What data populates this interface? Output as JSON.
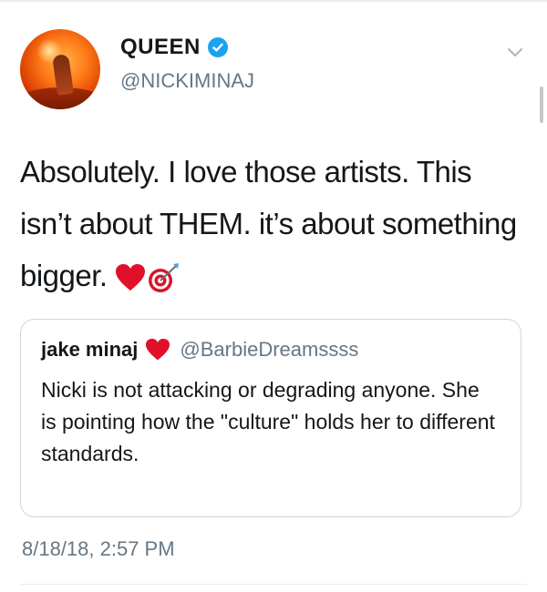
{
  "tweet": {
    "display_name": "QUEEN",
    "handle": "@NICKIMINAJ",
    "text": "Absolutely. I love those artists. This isn’t about THEM. it’s about something bigger.",
    "emojis": [
      "red-heart-icon",
      "direct-hit-icon"
    ],
    "timestamp": "8/18/18, 2:57 PM"
  },
  "quoted_tweet": {
    "display_name": "jake minaj",
    "handle": "@BarbieDreamssss",
    "text": "Nicki is not attacking or degrading anyone. She is pointing how the \"culture\" holds her to different standards."
  },
  "colors": {
    "verified": "#1da1f2",
    "secondary_text": "#657786",
    "border": "#ccd6dd",
    "heart": "#e0102a"
  }
}
